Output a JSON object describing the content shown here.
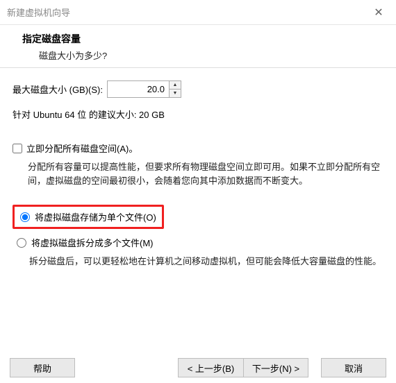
{
  "window": {
    "title": "新建虚拟机向导"
  },
  "header": {
    "title": "指定磁盘容量",
    "subtitle": "磁盘大小为多少?"
  },
  "disk": {
    "label": "最大磁盘大小 (GB)(S):",
    "value": "20.0",
    "recommended": "针对 Ubuntu 64 位 的建议大小: 20 GB"
  },
  "allocate": {
    "label": "立即分配所有磁盘空间(A)。",
    "checked": false,
    "desc": "分配所有容量可以提高性能，但要求所有物理磁盘空间立即可用。如果不立即分配所有空间，虚拟磁盘的空间最初很小，会随着您向其中添加数据而不断变大。"
  },
  "storage": {
    "single": {
      "label": "将虚拟磁盘存储为单个文件(O)"
    },
    "split": {
      "label": "将虚拟磁盘拆分成多个文件(M)",
      "desc": "拆分磁盘后，可以更轻松地在计算机之间移动虚拟机，但可能会降低大容量磁盘的性能。"
    },
    "selected": "single"
  },
  "footer": {
    "help": "帮助",
    "back": "< 上一步(B)",
    "next": "下一步(N) >",
    "cancel": "取消"
  }
}
